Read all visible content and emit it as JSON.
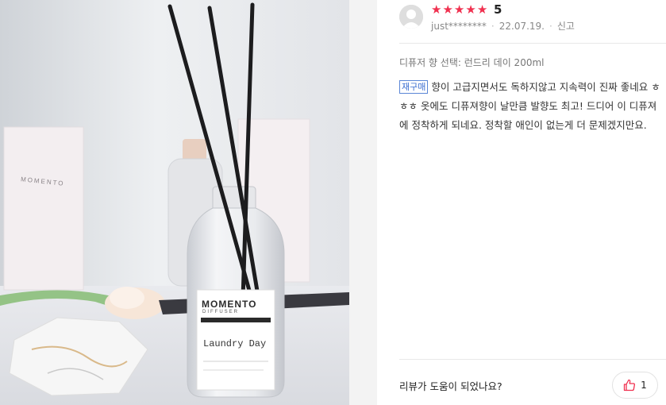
{
  "review": {
    "rating": 5,
    "score_label": "5",
    "stars": [
      "★",
      "★",
      "★",
      "★",
      "★"
    ],
    "user": "just********",
    "date": "22.07.19.",
    "report_label": "신고",
    "option": "디퓨저 향 선택: 런드리 데이 200ml",
    "repurchase_badge": "재구매",
    "text": "향이 고급지면서도 독하지않고 지속력이 진짜 좋네요 ㅎㅎㅎ 옷에도 디퓨져향이 날만큼 발향도 최고! 드디어 이 디퓨져에 정착하게 되네요. 정착할 애인이 없는게 더 문제겠지만요.",
    "helpful_question": "리뷰가 도움이 되었나요?",
    "helpful_count": "1"
  },
  "photo": {
    "brand": "MOMENTO",
    "sub": "DIFFUSER",
    "product_name": "Laundry Day",
    "box_brand": "MOMENTO"
  },
  "colors": {
    "star": "#f0304f",
    "badge": "#3c6fd1"
  },
  "icons": {
    "avatar": "default-user-icon",
    "like": "thumbs-up-icon"
  }
}
